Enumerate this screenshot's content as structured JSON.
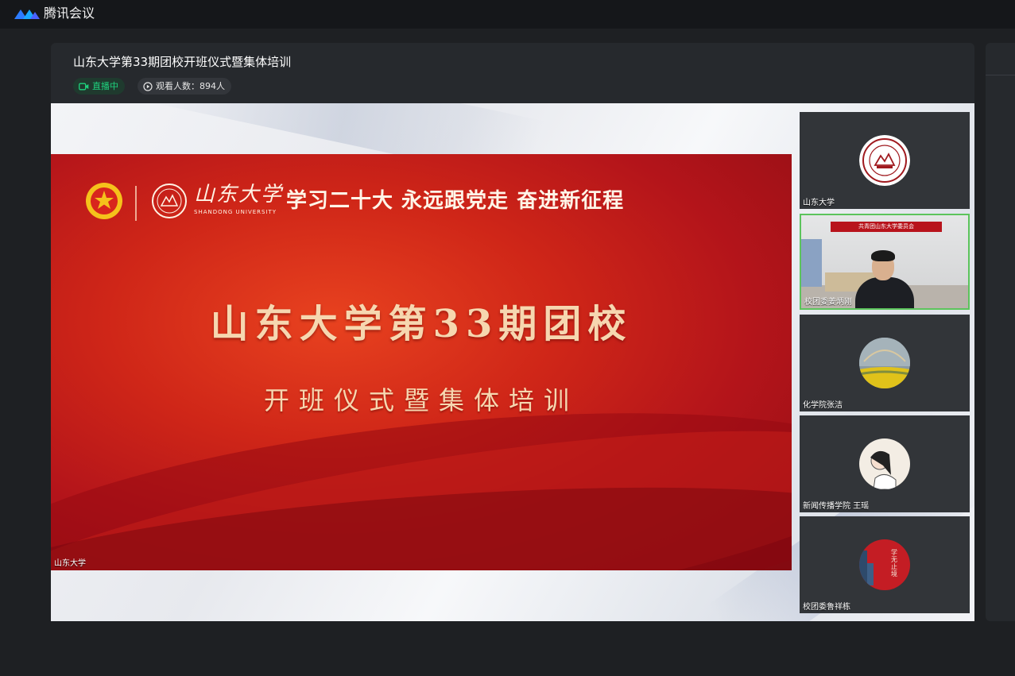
{
  "app": {
    "name": "腾讯会议",
    "brand_color": "#1e6bff"
  },
  "meeting": {
    "title": "山东大学第33期团校开班仪式暨集体培训",
    "live_status": "直播中",
    "viewer_count_label": "观看人数：894人",
    "live_color": "#1fd17d"
  },
  "slide": {
    "slogan": "学习二十大  永远跟党走  奋进新征程",
    "university_script": "山东大学",
    "university_en": "SHANDONG UNIVERSITY",
    "title": "山东大学第33期团校",
    "subtitle": "开班仪式暨集体培训",
    "presenter_label": "山东大学"
  },
  "participants": [
    {
      "name": "山东大学",
      "avatar": "university-seal-icon"
    },
    {
      "name": "校团委姜炳刚",
      "avatar": "camera-video",
      "video_banner": "共青团山东大学委员会",
      "active_speaker": true
    },
    {
      "name": "化学院张洁",
      "avatar": "sky-photo-avatar"
    },
    {
      "name": "新闻传播学院 王瑶",
      "avatar": "cartoon-avatar"
    },
    {
      "name": "校团委鲁祥栋",
      "avatar": "red-calligraphy-avatar",
      "avatar_text": "学无止境"
    }
  ]
}
